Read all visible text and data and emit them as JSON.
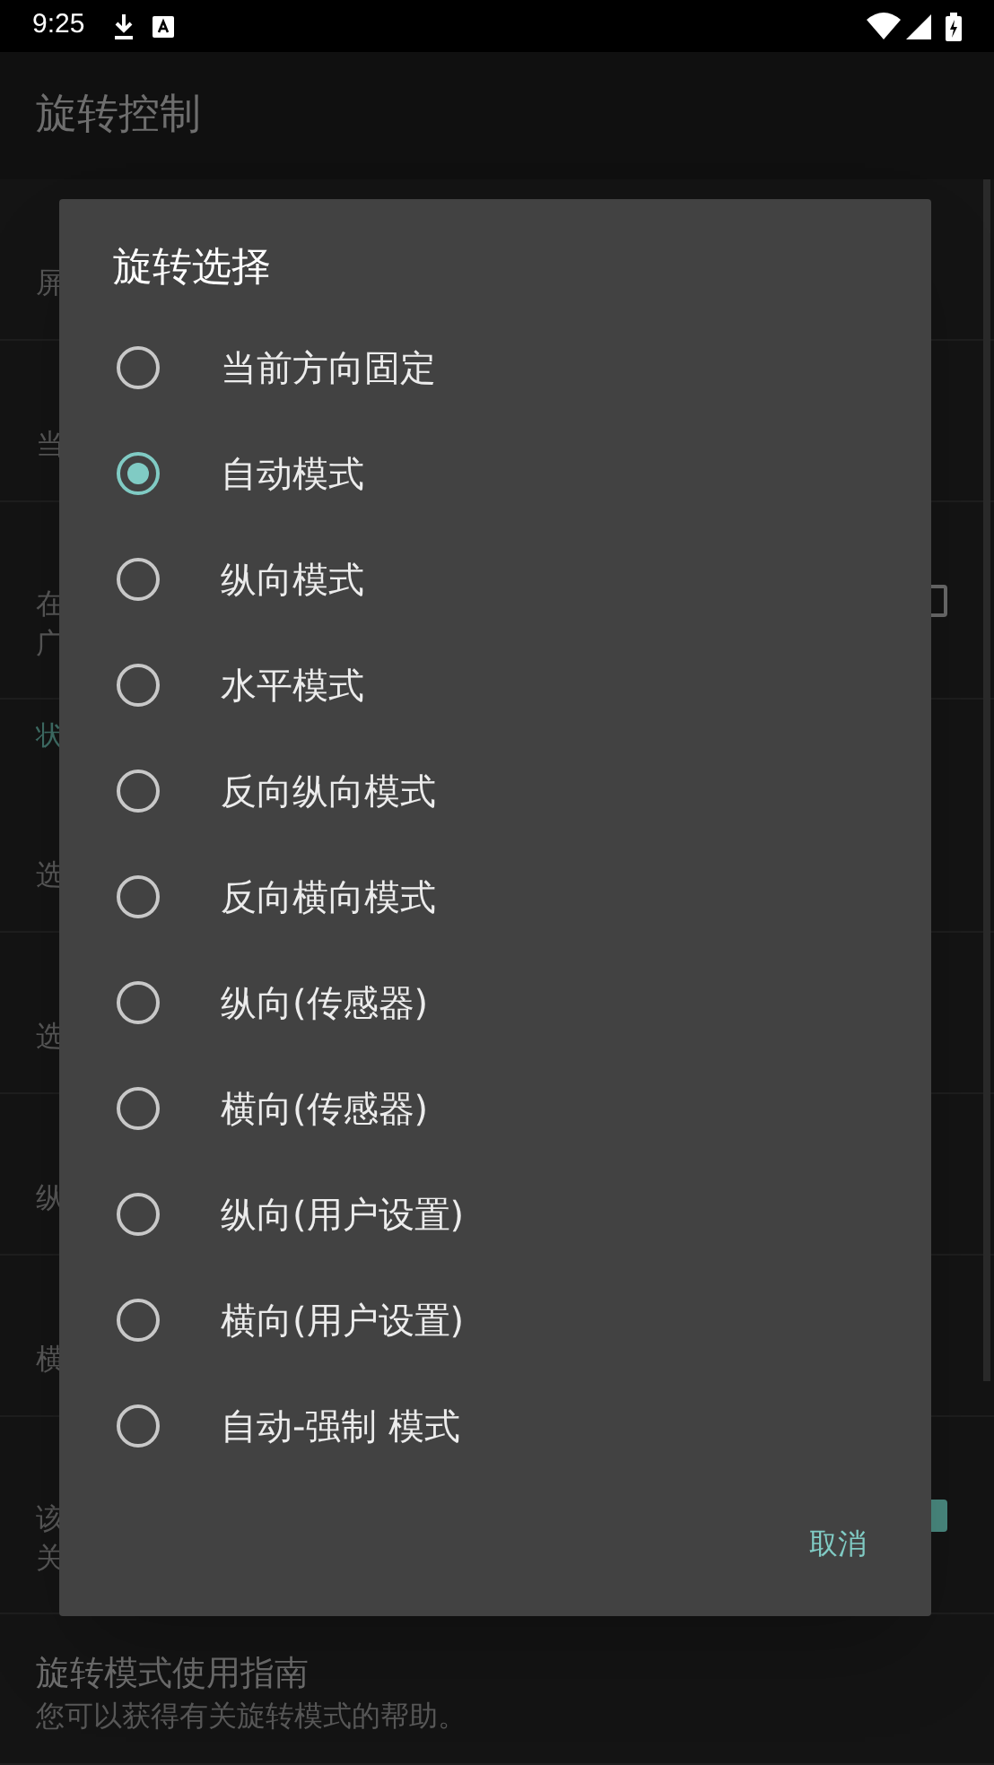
{
  "status_bar": {
    "time": "9:25"
  },
  "app_bar": {
    "title": "旋转控制"
  },
  "settings": {
    "items": [
      {
        "kind": "row",
        "summary": [
          "屏"
        ]
      },
      {
        "kind": "row",
        "summary": [
          "当"
        ]
      },
      {
        "kind": "row",
        "summary": [
          "在",
          "广"
        ],
        "checked": false
      },
      {
        "kind": "category",
        "title": "状"
      },
      {
        "kind": "row",
        "summary": [
          "选"
        ]
      },
      {
        "kind": "row",
        "summary": [
          "选"
        ]
      },
      {
        "kind": "row",
        "summary": [
          "纵"
        ]
      },
      {
        "kind": "row",
        "summary": [
          "横"
        ]
      },
      {
        "kind": "row",
        "summary": [
          "该",
          "关"
        ],
        "checked": true
      },
      {
        "kind": "row",
        "title": "旋转模式使用指南",
        "summary": [
          "您可以获得有关旋转模式的帮助。"
        ]
      }
    ]
  },
  "dialog": {
    "title": "旋转选择",
    "options": [
      {
        "label": "当前方向固定",
        "selected": false
      },
      {
        "label": "自动模式",
        "selected": true
      },
      {
        "label": "纵向模式",
        "selected": false
      },
      {
        "label": "水平模式",
        "selected": false
      },
      {
        "label": "反向纵向模式",
        "selected": false
      },
      {
        "label": "反向横向模式",
        "selected": false
      },
      {
        "label": "纵向(传感器)",
        "selected": false
      },
      {
        "label": "横向(传感器)",
        "selected": false
      },
      {
        "label": "纵向(用户设置)",
        "selected": false
      },
      {
        "label": "横向(用户设置)",
        "selected": false
      },
      {
        "label": "自动-强制 模式",
        "selected": false
      }
    ],
    "buttons": [
      "取消"
    ]
  }
}
